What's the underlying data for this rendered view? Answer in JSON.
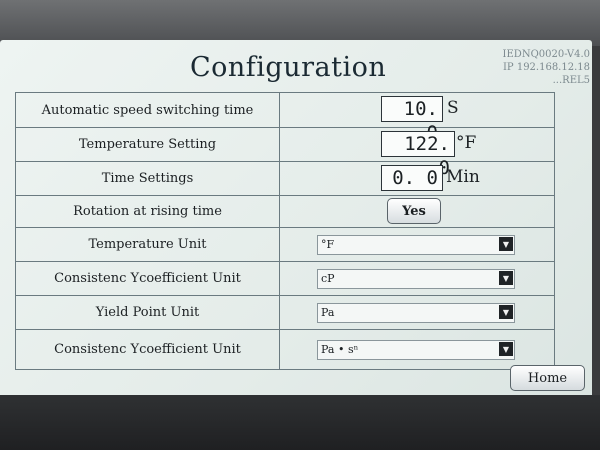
{
  "title": "Configuration",
  "info_lines": [
    "IEDNQ0020-V4.0",
    "IP 192.168.12.18",
    "...REL5"
  ],
  "rows": [
    {
      "label": "Automatic speed switching time",
      "value": "10. 0",
      "unit": "S"
    },
    {
      "label": "Temperature Setting",
      "value": "122. 0",
      "unit": "°F"
    },
    {
      "label": "Time Settings",
      "value": "0. 0",
      "unit": "Min"
    },
    {
      "label": "Rotation at rising time",
      "button": "Yes"
    },
    {
      "label": "Temperature Unit",
      "select": "°F"
    },
    {
      "label": "Consistenc Ycoefficient  Unit",
      "select": "cP"
    },
    {
      "label": "Yield Point Unit",
      "select": "Pa"
    },
    {
      "label": "Consistenc Ycoefficient  Unit",
      "select": "Pa • sⁿ"
    }
  ],
  "home_button": "Home",
  "icons": {
    "dropdown": "chevron-down-icon"
  }
}
